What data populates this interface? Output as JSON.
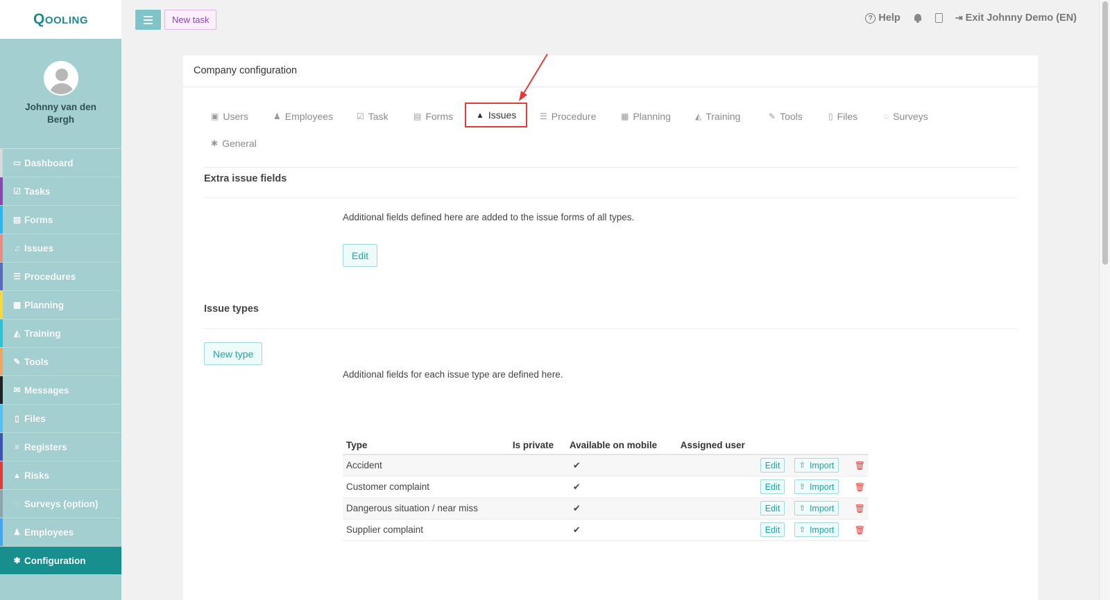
{
  "app": {
    "logo": "Qooling"
  },
  "user": {
    "name": "Johnny van den Bergh"
  },
  "sidebar": {
    "items": [
      {
        "label": "Dashboard",
        "icon": "monitor-icon",
        "glyph": "▭",
        "color": "#d9d9d9"
      },
      {
        "label": "Tasks",
        "icon": "checkbox-icon",
        "glyph": "☑",
        "color": "#8e44ad"
      },
      {
        "label": "Forms",
        "icon": "file-icon",
        "glyph": "▤",
        "color": "#29b6f6"
      },
      {
        "label": "Issues",
        "icon": "bell-icon",
        "glyph": "♫",
        "color": "#ef8a80"
      },
      {
        "label": "Procedures",
        "icon": "list-icon",
        "glyph": "☰",
        "color": "#5c6bc0"
      },
      {
        "label": "Planning",
        "icon": "calendar-icon",
        "glyph": "▦",
        "color": "#fdd835"
      },
      {
        "label": "Training",
        "icon": "graduation-cap-icon",
        "glyph": "◭",
        "color": "#26c6da"
      },
      {
        "label": "Tools",
        "icon": "wrench-icon",
        "glyph": "✎",
        "color": "#f4a460"
      },
      {
        "label": "Messages",
        "icon": "envelope-icon",
        "glyph": "✉",
        "color": "#222222"
      },
      {
        "label": "Files",
        "icon": "document-icon",
        "glyph": "▯",
        "color": "#4fc3f7"
      },
      {
        "label": "Registers",
        "icon": "menu-icon",
        "glyph": "≡",
        "color": "#3f51b5"
      },
      {
        "label": "Risks",
        "icon": "warning-icon",
        "glyph": "▲",
        "color": "#e53935"
      },
      {
        "label": "Surveys (option)",
        "icon": "comment-icon",
        "glyph": "◌",
        "color": "#90a4ae"
      },
      {
        "label": "Employees",
        "icon": "users-icon",
        "glyph": "♟",
        "color": "#42a5f5"
      },
      {
        "label": "Configuration",
        "icon": "gear-icon",
        "glyph": "✱",
        "color": "#168f8e",
        "active": true
      }
    ]
  },
  "topbar": {
    "new_task_label": "New task",
    "help_label": "Help",
    "exit_label": "Exit Johnny Demo (EN)"
  },
  "card": {
    "title": "Company configuration"
  },
  "tabs": [
    {
      "label": "Users",
      "icon": "id-card-icon",
      "glyph": "▣"
    },
    {
      "label": "Employees",
      "icon": "users-icon",
      "glyph": "♟"
    },
    {
      "label": "Task",
      "icon": "checkbox-icon",
      "glyph": "☑"
    },
    {
      "label": "Forms",
      "icon": "file-icon",
      "glyph": "▤"
    },
    {
      "label": "Issues",
      "icon": "bell-icon",
      "glyph": "🔔",
      "active": true
    },
    {
      "label": "Procedure",
      "icon": "list-icon",
      "glyph": "☰"
    },
    {
      "label": "Planning",
      "icon": "calendar-icon",
      "glyph": "▦"
    },
    {
      "label": "Training",
      "icon": "graduation-cap-icon",
      "glyph": "◭"
    },
    {
      "label": "Tools",
      "icon": "wrench-icon",
      "glyph": "✎"
    },
    {
      "label": "Files",
      "icon": "document-icon",
      "glyph": "▯"
    },
    {
      "label": "Surveys",
      "icon": "comment-icon",
      "glyph": "◌"
    },
    {
      "label": "General",
      "icon": "gear-icon",
      "glyph": "✱"
    }
  ],
  "extra_fields": {
    "title": "Extra issue fields",
    "description": "Additional fields defined here are added to the issue forms of all types.",
    "edit_label": "Edit"
  },
  "issue_types": {
    "title": "Issue types",
    "new_type_label": "New type",
    "description": "Additional fields for each issue type are defined here.",
    "columns": [
      "Type",
      "Is private",
      "Available on mobile",
      "Assigned user"
    ],
    "edit_label": "Edit",
    "import_label": "Import",
    "rows": [
      {
        "type": "Accident",
        "is_private": "",
        "mobile": "✔",
        "assigned_user": ""
      },
      {
        "type": "Customer complaint",
        "is_private": "",
        "mobile": "✔",
        "assigned_user": ""
      },
      {
        "type": "Dangerous situation / near miss",
        "is_private": "",
        "mobile": "✔",
        "assigned_user": ""
      },
      {
        "type": "Supplier complaint",
        "is_private": "",
        "mobile": "✔",
        "assigned_user": ""
      }
    ]
  },
  "colors": {
    "accent": "#1fa3a5",
    "sidebar": "#a3cfd1",
    "active_nav": "#168f8e",
    "highlight": "#e53935"
  }
}
